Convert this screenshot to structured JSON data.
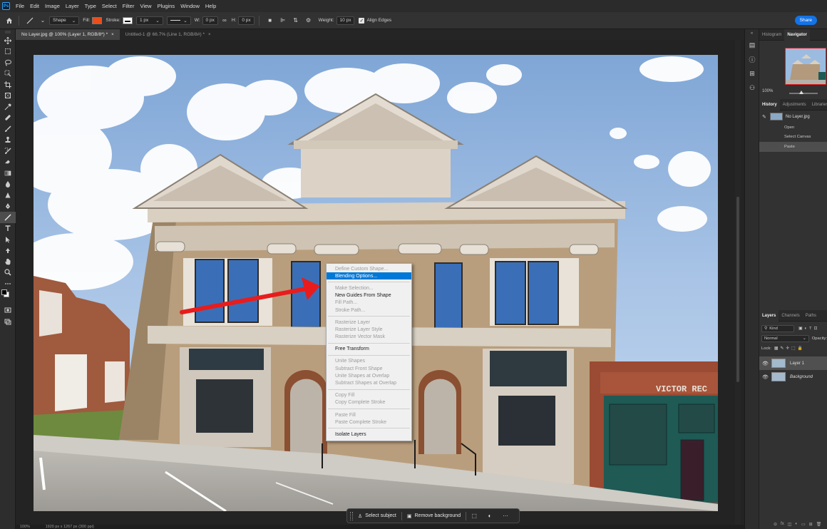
{
  "menubar": {
    "logo": "Ps",
    "items": [
      "File",
      "Edit",
      "Image",
      "Layer",
      "Type",
      "Select",
      "Filter",
      "View",
      "Plugins",
      "Window",
      "Help"
    ]
  },
  "options": {
    "mode": "Shape",
    "fill_label": "Fill:",
    "stroke_label": "Stroke:",
    "stroke_width": "1 px",
    "w_label": "W:",
    "w_value": "0 px",
    "h_label": "H:",
    "h_value": "0 px",
    "weight_label": "Weight:",
    "weight_value": "10 px",
    "align_edges": "Align Edges",
    "share": "Share",
    "fill_color": "#e94e1b",
    "stroke_color": "#ffffff"
  },
  "tabs": [
    {
      "label": "No Layer.jpg @ 100% (Layer 1, RGB/8*) *",
      "close": "×"
    },
    {
      "label": "Untitled-1 @ 66.7% (Line 1, RGB/8#) *",
      "close": "×"
    }
  ],
  "context_menu": {
    "items": [
      {
        "label": "Define Custom Shape...",
        "state": "disabled"
      },
      {
        "label": "Blending Options...",
        "state": "highlighted"
      },
      {
        "sep": true
      },
      {
        "label": "Make Selection...",
        "state": "disabled"
      },
      {
        "label": "New Guides From Shape",
        "state": "enabled"
      },
      {
        "label": "Fill Path...",
        "state": "disabled"
      },
      {
        "label": "Stroke Path...",
        "state": "disabled"
      },
      {
        "sep": true
      },
      {
        "label": "Rasterize Layer",
        "state": "disabled"
      },
      {
        "label": "Rasterize Layer Style",
        "state": "disabled"
      },
      {
        "label": "Rasterize Vector Mask",
        "state": "disabled"
      },
      {
        "sep": true
      },
      {
        "label": "Free Transform",
        "state": "enabled"
      },
      {
        "sep": true
      },
      {
        "label": "Unite Shapes",
        "state": "disabled"
      },
      {
        "label": "Subtract Front Shape",
        "state": "disabled"
      },
      {
        "label": "Unite Shapes at Overlap",
        "state": "disabled"
      },
      {
        "label": "Subtract Shapes at Overlap",
        "state": "disabled"
      },
      {
        "sep": true
      },
      {
        "label": "Copy Fill",
        "state": "disabled"
      },
      {
        "label": "Copy Complete Stroke",
        "state": "disabled"
      },
      {
        "sep": true
      },
      {
        "label": "Paste Fill",
        "state": "disabled"
      },
      {
        "label": "Paste Complete Stroke",
        "state": "disabled"
      },
      {
        "sep": true
      },
      {
        "label": "Isolate Layers",
        "state": "enabled"
      }
    ]
  },
  "taskbar": {
    "select_subject": "Select subject",
    "remove_background": "Remove background"
  },
  "statusbar": {
    "zoom": "100%",
    "doc_info": "1920 px x 1267 px (300 ppi)"
  },
  "image": {
    "store_sign": "VICTOR REC"
  },
  "panels": {
    "nav_tabs": [
      "Histogram",
      "Navigator"
    ],
    "zoom": "100%",
    "history_tabs": [
      "History",
      "Adjustments",
      "Libraries"
    ],
    "snapshot": "No Layer.jpg",
    "history_steps": [
      "Open",
      "Select Canvas",
      "Paste"
    ],
    "layer_tabs": [
      "Layers",
      "Channels",
      "Paths"
    ],
    "kind": "Kind",
    "blend_mode": "Normal",
    "opacity_label": "Opacity:",
    "lock_label": "Lock:",
    "layers": [
      {
        "name": "Layer 1",
        "selected": true
      },
      {
        "name": "Background",
        "selected": false
      }
    ]
  }
}
